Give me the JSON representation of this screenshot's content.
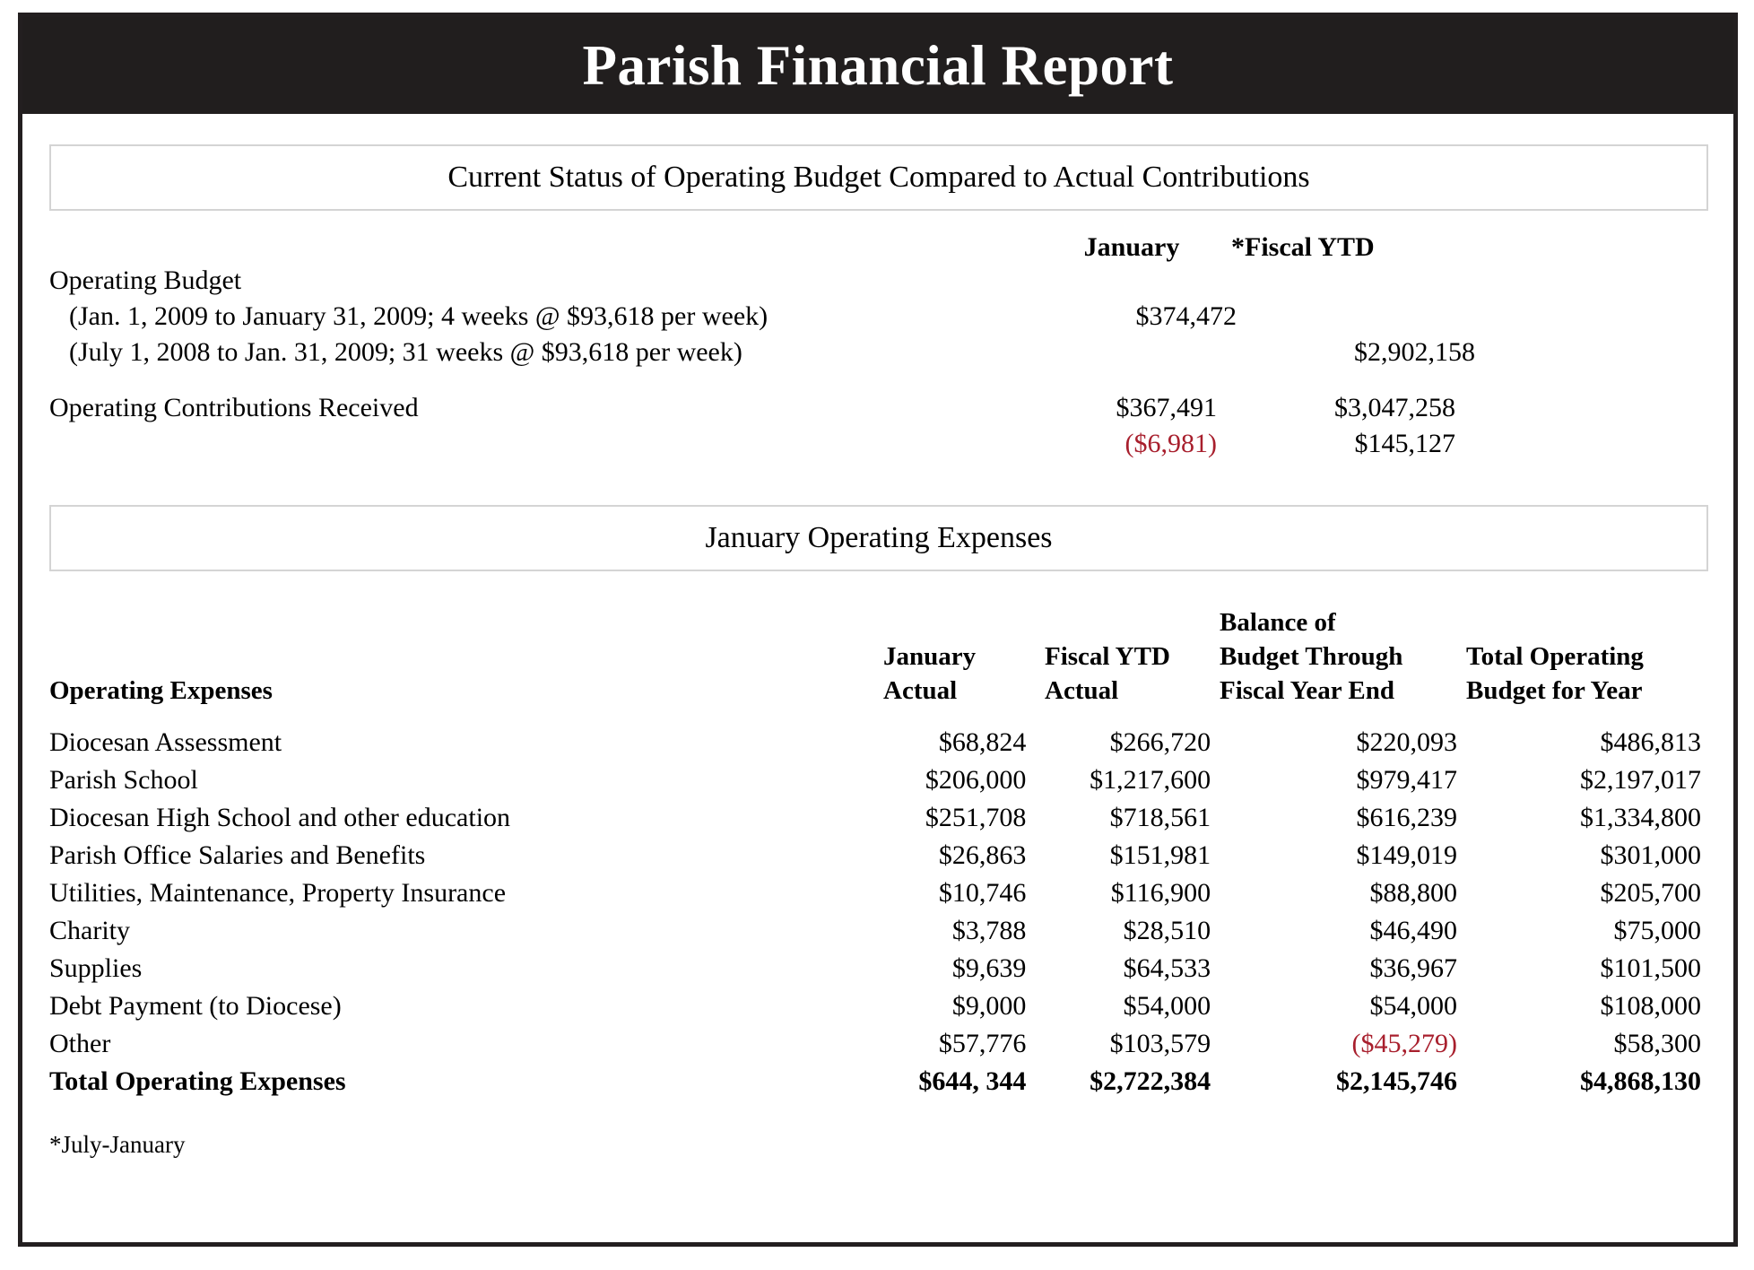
{
  "report": {
    "title": "Parish Financial Report",
    "footnote": "*July-January"
  },
  "colors": {
    "title_bar": "#211e1e",
    "negative": "#a81f2d",
    "frame": "#231f20",
    "box_border": "#d4d4d4"
  },
  "budget_section": {
    "heading": "Current Status of Operating Budget Compared to Actual Contributions",
    "col_headers": {
      "january": "January",
      "fiscal_ytd": "*Fiscal YTD"
    },
    "rows": [
      {
        "label": "Operating Budget",
        "january": "",
        "fiscal_ytd": ""
      },
      {
        "label": "(Jan. 1, 2009 to January 31, 2009; 4 weeks @ $93,618 per week)",
        "january": "$374,472",
        "fiscal_ytd": ""
      },
      {
        "label": "(July 1, 2008 to Jan. 31, 2009; 31 weeks @ $93,618 per week)",
        "january": "",
        "fiscal_ytd": "$2,902,158"
      }
    ],
    "contributions": {
      "label": "Operating Contributions Received",
      "january": "$367,491",
      "fiscal_ytd": "$3,047,258"
    },
    "variance": {
      "january": "($6,981)",
      "january_negative": true,
      "fiscal_ytd": "$145,127",
      "fiscal_ytd_negative": false
    }
  },
  "expenses_section": {
    "heading": "January Operating Expenses",
    "row_header_label": "Operating Expenses",
    "col_headers": [
      "January\nActual",
      "Fiscal YTD\nActual",
      "Balance of\nBudget Through\nFiscal Year End",
      "Total Operating\nBudget for Year"
    ],
    "col_headers_lines": {
      "c1": [
        "January",
        "Actual"
      ],
      "c2": [
        "Fiscal YTD",
        "Actual"
      ],
      "c3": [
        "Balance of",
        "Budget Through",
        "Fiscal Year End"
      ],
      "c4": [
        "Total Operating",
        "Budget for Year"
      ]
    },
    "rows": [
      {
        "label": "Diocesan Assessment",
        "january_actual": "$68,824",
        "fiscal_ytd_actual": "$266,720",
        "balance_through_year_end": "$220,093",
        "total_budget_for_year": "$486,813",
        "balance_negative": false
      },
      {
        "label": "Parish School",
        "january_actual": "$206,000",
        "fiscal_ytd_actual": "$1,217,600",
        "balance_through_year_end": "$979,417",
        "total_budget_for_year": "$2,197,017",
        "balance_negative": false
      },
      {
        "label": "Diocesan High School and other education",
        "january_actual": "$251,708",
        "fiscal_ytd_actual": "$718,561",
        "balance_through_year_end": "$616,239",
        "total_budget_for_year": "$1,334,800",
        "balance_negative": false
      },
      {
        "label": "Parish Office Salaries and Benefits",
        "january_actual": "$26,863",
        "fiscal_ytd_actual": "$151,981",
        "balance_through_year_end": "$149,019",
        "total_budget_for_year": "$301,000",
        "balance_negative": false
      },
      {
        "label": "Utilities, Maintenance, Property Insurance",
        "january_actual": "$10,746",
        "fiscal_ytd_actual": "$116,900",
        "balance_through_year_end": "$88,800",
        "total_budget_for_year": "$205,700",
        "balance_negative": false
      },
      {
        "label": "Charity",
        "january_actual": "$3,788",
        "fiscal_ytd_actual": "$28,510",
        "balance_through_year_end": "$46,490",
        "total_budget_for_year": "$75,000",
        "balance_negative": false
      },
      {
        "label": "Supplies",
        "january_actual": "$9,639",
        "fiscal_ytd_actual": "$64,533",
        "balance_through_year_end": "$36,967",
        "total_budget_for_year": "$101,500",
        "balance_negative": false
      },
      {
        "label": "Debt Payment (to Diocese)",
        "january_actual": "$9,000",
        "fiscal_ytd_actual": "$54,000",
        "balance_through_year_end": "$54,000",
        "total_budget_for_year": "$108,000",
        "balance_negative": false
      },
      {
        "label": "Other",
        "january_actual": "$57,776",
        "fiscal_ytd_actual": "$103,579",
        "balance_through_year_end": "($45,279)",
        "total_budget_for_year": "$58,300",
        "balance_negative": true
      }
    ],
    "total_row": {
      "label": "Total Operating Expenses",
      "january_actual": "$644, 344",
      "fiscal_ytd_actual": "$2,722,384",
      "balance_through_year_end": "$2,145,746",
      "total_budget_for_year": "$4,868,130"
    }
  }
}
